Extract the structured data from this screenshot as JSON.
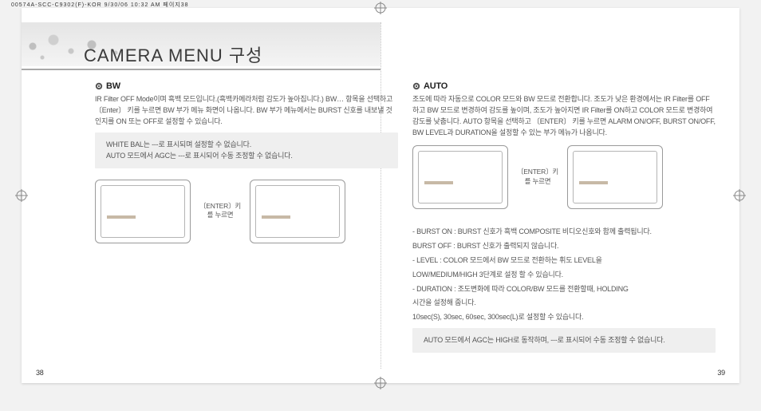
{
  "header": "00574A-SCC-C9302(F)-KOR  9/30/06 10:32 AM  페이지38",
  "title": "CAMERA MENU 구성",
  "left": {
    "head": "BW",
    "p1": "IR Filter OFF Mode이며 흑백 모드입니다.(흑백카메라처럼 감도가 높아집니다.) BW… 항목을 선택하고 〔Enter〕 키를 누르면 BW 부가 메뉴 화면이 나옵니다. BW 부가 메뉴에서는 BURST 신호를 내보낼 것인지를 ON 또는 OFF로 설정할 수 있습니다.",
    "note": "WHITE BAL는 ---로 표시되며 설정할 수 없습니다.\nAUTO 모드에서 AGC는 ---로 표시되어 수동 조정할 수 없습니다.",
    "enter": "〔ENTER〕키를 누르면"
  },
  "right": {
    "head": "AUTO",
    "p1": "조도에 따라 자동으로 COLOR 모드와 BW 모드로 전환합니다. 조도가 낮은 환경에서는 IR Filter를 OFF하고 BW 모드로 변경하여 감도를 높이며, 조도가 높아지면 IR Filter를 ON하고 COLOR 모드로 변경하여 감도를 낮춥니다. AUTO 항목을 선택하고 〔ENTER〕 키를 누르면 ALARM ON/OFF, BURST ON/OFF, BW LEVEL과 DURATION을 설정할 수 있는 부가 메뉴가 나옵니다.",
    "enter": "〔ENTER〕키를 누르면",
    "b1": "- BURST ON : BURST 신호가 흑백 COMPOSITE 비디오신호와 함께 출력됩니다.",
    "b1b": "  BURST OFF : BURST 신호가 출력되지 않습니다.",
    "b2": "- LEVEL : COLOR 모드에서 BW 모드로 전환하는 휘도 LEVEL을",
    "b2b": "  LOW/MEDIUM/HIGH 3단계로 설정 할 수 있습니다.",
    "b3": "- DURATION : 조도변화에 따라 COLOR/BW 모드를 전환할때, HOLDING",
    "b3b": "  시간을 설정해 줍니다.",
    "b3c": "  10sec(S), 30sec, 60sec, 300sec(L)로 설정할 수 있습니다.",
    "note": "AUTO 모드에서 AGC는 HIGH로 동작하며, ---로 표시되어 수동 조정할 수 없습니다."
  },
  "pages": {
    "left": "38",
    "right": "39"
  }
}
